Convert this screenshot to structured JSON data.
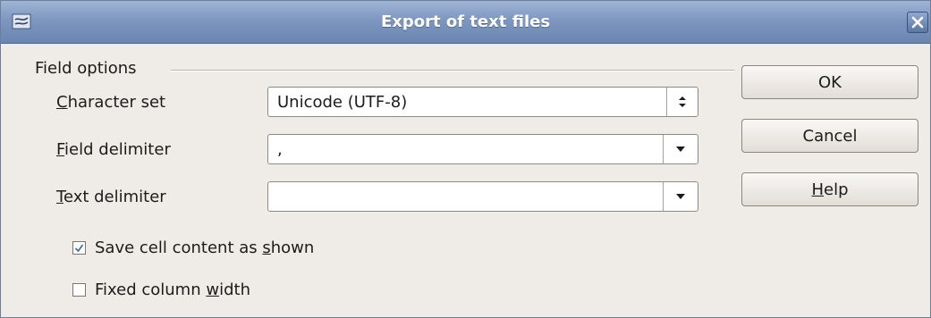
{
  "window": {
    "title": "Export of text files",
    "icon": "app-document-icon",
    "close_icon": "close-icon"
  },
  "group": {
    "title": "Field options"
  },
  "fields": {
    "character_set": {
      "label_mnemonic": "C",
      "label_rest": "haracter set",
      "value": "Unicode (UTF-8)"
    },
    "field_delimiter": {
      "label_mnemonic": "F",
      "label_rest": "ield delimiter",
      "value": ","
    },
    "text_delimiter": {
      "label_mnemonic": "T",
      "label_rest": "ext delimiter",
      "value": ""
    }
  },
  "checkboxes": {
    "save_as_shown": {
      "label_before": "Save cell content as ",
      "label_mnemonic": "s",
      "label_after": "hown",
      "checked": true
    },
    "fixed_width": {
      "label_before": "Fixed column ",
      "label_mnemonic": "w",
      "label_after": "idth",
      "checked": false
    }
  },
  "buttons": {
    "ok": "OK",
    "cancel": "Cancel",
    "help_mnemonic": "H",
    "help_rest": "elp"
  },
  "colors": {
    "title_bar": "#7e97c0",
    "dialog_bg": "#efebe7",
    "check_mark": "#4a6fa5"
  }
}
